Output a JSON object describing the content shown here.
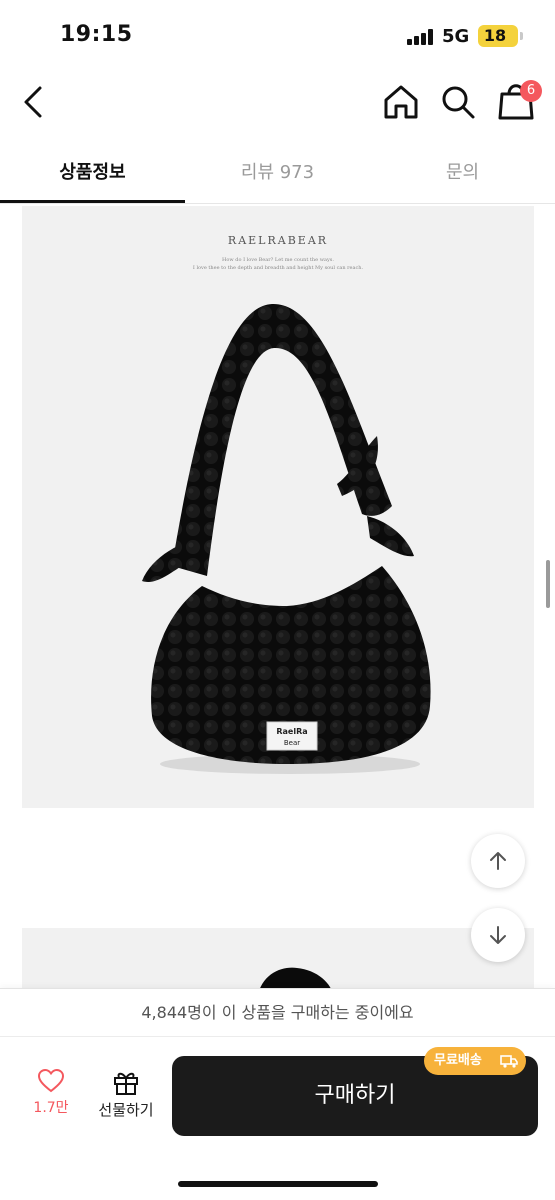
{
  "status": {
    "time": "19:15",
    "network": "5G",
    "battery": "18"
  },
  "nav": {
    "icons": [
      "back-icon",
      "home-icon",
      "search-icon",
      "shopping-bag-icon"
    ],
    "cart_badge": "6"
  },
  "tabs": [
    {
      "label": "상품정보",
      "active": true
    },
    {
      "label": "리뷰 973",
      "active": false
    },
    {
      "label": "문의",
      "active": false
    }
  ],
  "product_image": {
    "brand": "RAELRABEAR",
    "tagline_1": "How do I love Bear? Let me count the ways.",
    "tagline_2": "I love thee to the depth and breadth and height My soul can reach.",
    "bag_label_1": "RaelRa",
    "bag_label_2": "Bear"
  },
  "scroll_buttons": [
    "arrow-up-icon",
    "arrow-down-icon"
  ],
  "bottom": {
    "buyers_text": "4,844명이 이 상품을 구매하는 중이에요",
    "like_count": "1.7만",
    "gift_label": "선물하기",
    "buy_label": "구매하기",
    "free_shipping_label": "무료배송"
  },
  "colors": {
    "accent": "#f4585e",
    "badge_orange": "#f7b23b",
    "buy_button": "#1b1b1b",
    "battery": "#f4d23c"
  }
}
